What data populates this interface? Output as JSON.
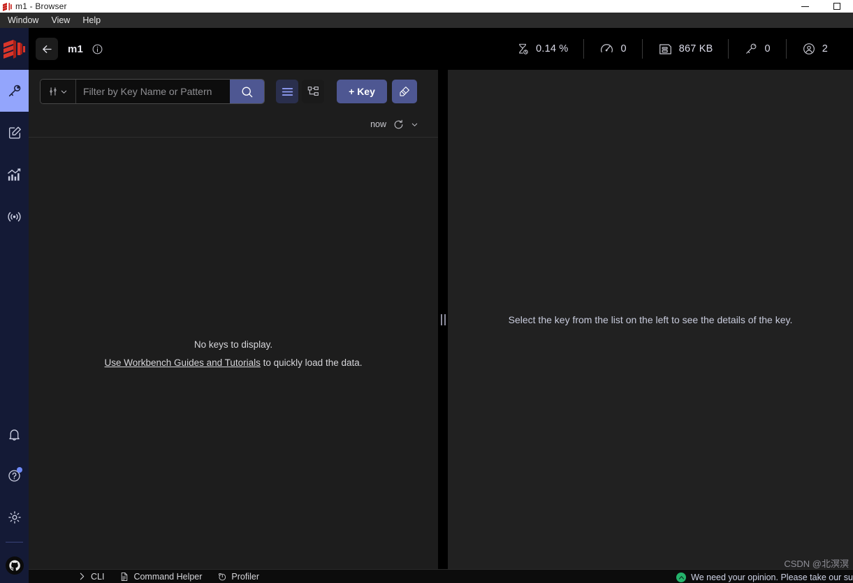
{
  "titlebar": {
    "title": "m1 - Browser",
    "logo_icon": "redis-logo-icon",
    "minimize_label": "Minimize",
    "maximize_label": "Maximize"
  },
  "menubar": {
    "items": [
      {
        "label": "Window"
      },
      {
        "label": "View"
      },
      {
        "label": "Help"
      }
    ]
  },
  "sidebar": {
    "brand_icon": "redis-logo-icon",
    "items": [
      {
        "name": "browser",
        "icon": "key-icon",
        "active": true
      },
      {
        "name": "workbench",
        "icon": "edit-square-icon",
        "active": false
      },
      {
        "name": "analysis-tools",
        "icon": "chart-bars-icon",
        "active": false
      },
      {
        "name": "pub-sub",
        "icon": "broadcast-icon",
        "active": false
      }
    ],
    "bottom_items": [
      {
        "name": "notifications",
        "icon": "bell-icon",
        "badge": false
      },
      {
        "name": "help",
        "icon": "question-circle-icon",
        "badge": true
      },
      {
        "name": "settings",
        "icon": "gear-icon",
        "badge": false
      },
      {
        "name": "github",
        "icon": "github-icon",
        "badge": false
      }
    ]
  },
  "header": {
    "back_icon": "arrow-left-icon",
    "db_name": "m1",
    "info_icon": "info-circle-icon",
    "stats": [
      {
        "name": "cpu",
        "icon": "hourglass-icon",
        "value": "0.14 %"
      },
      {
        "name": "commands-per-sec",
        "icon": "speedometer-icon",
        "value": "0"
      },
      {
        "name": "memory",
        "icon": "memory-chip-icon",
        "value": "867 KB"
      },
      {
        "name": "keys",
        "icon": "key-icon",
        "value": "0"
      },
      {
        "name": "connected-clients",
        "icon": "user-circle-icon",
        "value": "2"
      }
    ]
  },
  "browser": {
    "filter": {
      "type_icon": "sliders-icon",
      "type_chevron_icon": "chevron-down-icon",
      "placeholder": "Filter by Key Name or Pattern",
      "value": "",
      "search_icon": "search-icon"
    },
    "view_list_icon": "list-view-icon",
    "view_tree_icon": "tree-view-icon",
    "add_key_label": "+ Key",
    "bulk_actions_icon": "bulk-actions-icon",
    "refresh": {
      "label": "now",
      "icon": "refresh-icon",
      "chevron_icon": "chevron-down-icon"
    },
    "empty": {
      "line1": "No keys to display.",
      "link": "Use Workbench Guides and Tutorials",
      "line2_tail": " to quickly load the data."
    }
  },
  "details_panel": {
    "empty_text": "Select the key from the list on the left to see the details of the key."
  },
  "splitter": {
    "name": "panel-splitter"
  },
  "bottombar": {
    "items": [
      {
        "name": "cli",
        "icon": "chevron-right-icon",
        "label": "CLI"
      },
      {
        "name": "command-helper",
        "icon": "document-icon",
        "label": "Command Helper"
      },
      {
        "name": "profiler",
        "icon": "profiler-icon",
        "label": "Profiler"
      }
    ],
    "toast": {
      "icon": "survey-icon",
      "text": "We need your opinion. Please take our su"
    }
  },
  "watermark": {
    "text": "CSDN @北溟溟"
  },
  "colors": {
    "accent": "#4e5792",
    "sidebar_bg": "#141a36",
    "sidebar_active": "#93a5fc",
    "redis_red": "#d8352a",
    "panel_bg": "#1d1d1d",
    "details_bg": "#212121",
    "toast_green": "#24b36b"
  }
}
